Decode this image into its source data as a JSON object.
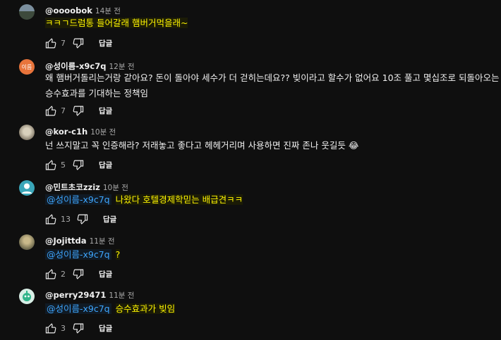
{
  "comments": [
    {
      "author": "@oooobok",
      "time": "14분 전",
      "mention": "",
      "text": "ㅋㅋㄱ드럼통 들어갈래 햄버거먹을래~",
      "line2": "",
      "likes": "7",
      "reply_label": "답글",
      "highlight": true,
      "emoji": "",
      "avatar_text": ""
    },
    {
      "author": "@성이름-x9c7q",
      "time": "12분 전",
      "mention": "",
      "text": "왜 햄버거돌리는거랑 같아요? 돈이 돌아야 세수가 더 걷히는데요?? 빚이라고 할수가 없어요 10조 풀고 몇십조로 되돌아오는",
      "line2": "승수효과를 기대하는 정책임",
      "likes": "7",
      "reply_label": "답글",
      "highlight": false,
      "emoji": "",
      "avatar_text": "이름"
    },
    {
      "author": "@kor-c1h",
      "time": "10분 전",
      "mention": "",
      "text": "넌 쓰지말고 꼭 인증해라? 저래놓고 좋다고 헤헤거리며 사용하면 진짜 존나 웃길듯",
      "line2": "",
      "likes": "5",
      "reply_label": "답글",
      "highlight": false,
      "emoji": "😂",
      "avatar_text": ""
    },
    {
      "author": "@민트초코zziz",
      "time": "10분 전",
      "mention": "@성이름-x9c7q",
      "text": "나왔다 호텔경제학믿는 배급견ㅋㅋ",
      "line2": "",
      "likes": "13",
      "reply_label": "답글",
      "highlight": true,
      "emoji": "",
      "avatar_text": ""
    },
    {
      "author": "@Jojittda",
      "time": "11분 전",
      "mention": "@성이름-x9c7q",
      "text": "?",
      "line2": "",
      "likes": "2",
      "reply_label": "답글",
      "highlight": true,
      "emoji": "",
      "avatar_text": ""
    },
    {
      "author": "@perry29471",
      "time": "11분 전",
      "mention": "@성이름-x9c7q",
      "text": "승수효과가 빚임",
      "line2": "",
      "likes": "3",
      "reply_label": "답글",
      "highlight": true,
      "emoji": "",
      "avatar_text": ""
    }
  ],
  "colors": {
    "background": "#0f0f0f",
    "highlight_text": "#fff600",
    "mention": "#3ea6ff",
    "avatar_orange": "#e8743b",
    "avatar_teal": "#3aa6b9"
  }
}
